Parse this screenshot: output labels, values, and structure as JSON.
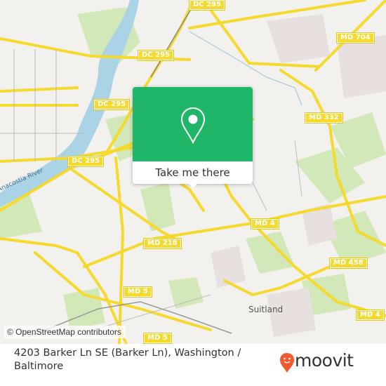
{
  "map": {
    "road_shields": [
      {
        "label": "DC 295",
        "id": "dc295-top"
      },
      {
        "label": "DC 295",
        "id": "dc295-upper"
      },
      {
        "label": "DC 295",
        "id": "dc295-mid"
      },
      {
        "label": "DC 295",
        "id": "dc295-lower"
      },
      {
        "label": "MD 704",
        "id": "md704"
      },
      {
        "label": "MD 332",
        "id": "md332"
      },
      {
        "label": "MD 4",
        "id": "md4-mid"
      },
      {
        "label": "MD 4",
        "id": "md4-lower"
      },
      {
        "label": "MD 218",
        "id": "md218"
      },
      {
        "label": "MD 458",
        "id": "md458"
      },
      {
        "label": "MD 5",
        "id": "md5-mid"
      },
      {
        "label": "MD 5",
        "id": "md5-lower"
      }
    ],
    "places": {
      "suitland": "Suitland",
      "river": "Anacostia River"
    },
    "attribution": "© OpenStreetMap contributors",
    "colors": {
      "land": "#f2f1ee",
      "water": "#abd3e6",
      "park": "#cfe6b0",
      "road": "#f5d92c",
      "road_casing": "#e6c43a"
    }
  },
  "popup": {
    "icon": "map-pin-icon",
    "button_label": "Take me there",
    "color": "#1fb667"
  },
  "footer": {
    "address": "4203 Barker Ln SE (Barker Ln), Washington / Baltimore",
    "brand": "moovit",
    "brand_color": "#f15a2c"
  }
}
